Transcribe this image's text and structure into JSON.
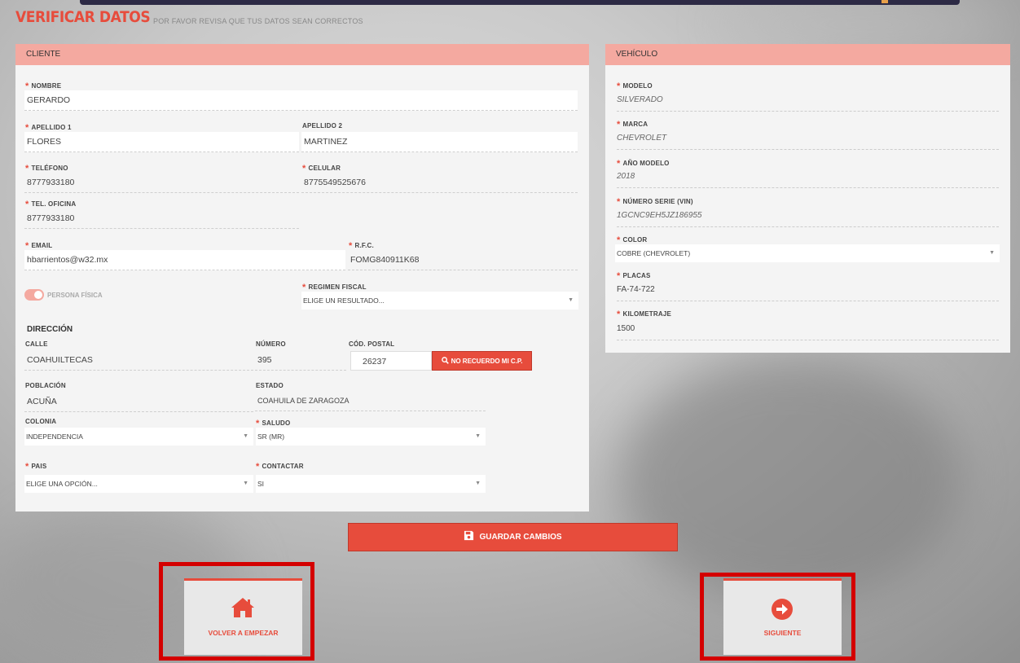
{
  "header": {
    "title": "VERIFICAR DATOS",
    "subtitle": "POR FAVOR REVISA QUE TUS DATOS SEAN CORRECTOS"
  },
  "client": {
    "heading": "CLIENTE",
    "nombre": {
      "label": "NOMBRE",
      "value": "GERARDO"
    },
    "apellido1": {
      "label": "APELLIDO 1",
      "value": "FLORES"
    },
    "apellido2": {
      "label": "APELLIDO 2",
      "value": "MARTINEZ"
    },
    "telefono": {
      "label": "TELÉFONO",
      "value": "8777933180"
    },
    "celular": {
      "label": "CELULAR",
      "value": "8775549525676"
    },
    "tel_oficina": {
      "label": "TEL. OFICINA",
      "value": "8777933180"
    },
    "email": {
      "label": "EMAIL",
      "value": "hbarrientos@w32.mx"
    },
    "rfc": {
      "label": "R.F.C.",
      "value": "FOMG840911K68"
    },
    "persona_fisica": {
      "label": "PERSONA FÍSICA"
    },
    "regimen_fiscal": {
      "label": "REGIMEN FISCAL",
      "value": "ELIGE UN RESULTADO..."
    },
    "direccion": {
      "heading": "DIRECCIÓN",
      "calle": {
        "label": "CALLE",
        "value": "COAHUILTECAS"
      },
      "numero": {
        "label": "NÚMERO",
        "value": "395"
      },
      "cp": {
        "label": "CÓD. POSTAL",
        "value": "26237"
      },
      "cp_button": "NO RECUERDO MI C.P.",
      "poblacion": {
        "label": "POBLACIÓN",
        "value": "ACUÑA"
      },
      "estado": {
        "label": "ESTADO",
        "value": "COAHUILA DE ZARAGOZA"
      },
      "colonia": {
        "label": "COLONIA",
        "value": "INDEPENDENCIA"
      },
      "saludo": {
        "label": "SALUDO",
        "value": "SR (MR)"
      },
      "pais": {
        "label": "PAIS",
        "value": "ELIGE UNA OPCIÓN..."
      },
      "contactar": {
        "label": "CONTACTAR",
        "value": "SI"
      }
    }
  },
  "vehicle": {
    "heading": "VEHÍCULO",
    "modelo": {
      "label": "MODELO",
      "value": "SILVERADO"
    },
    "marca": {
      "label": "MARCA",
      "value": "CHEVROLET"
    },
    "anio": {
      "label": "AÑO MODELO",
      "value": "2018"
    },
    "vin": {
      "label": "NÚMERO SERIE (VIN)",
      "value": "1GCNC9EH5JZ186955"
    },
    "color": {
      "label": "COLOR",
      "value": "COBRE (CHEVROLET)"
    },
    "placas": {
      "label": "PLACAS",
      "value": "FA-74-722"
    },
    "kilometraje": {
      "label": "KILOMETRAJE",
      "value": "1500"
    }
  },
  "actions": {
    "save_label": "GUARDAR CAMBIOS",
    "restart_label": "VOLVER A EMPEZAR",
    "next_label": "SIGUIENTE"
  },
  "colors": {
    "accent": "#e74c3c",
    "panel_head": "#f4a9a0",
    "highlight": "#d40000"
  },
  "icons": [
    "save-icon",
    "search-icon",
    "home-icon",
    "arrow-right-circle-icon",
    "chevron-down-icon"
  ]
}
